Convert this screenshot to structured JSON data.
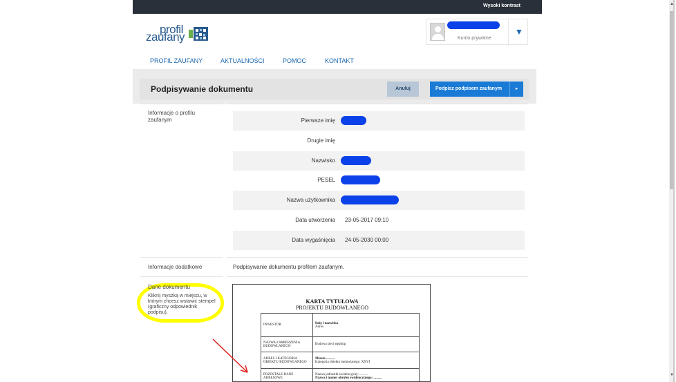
{
  "topbar": {
    "contrast_label": "Wysoki kontrast"
  },
  "logo": {
    "line1": "profil",
    "line2": "zaufany"
  },
  "account": {
    "type_label": "Konto prywatne",
    "chevron": "▼"
  },
  "nav": {
    "items": [
      "PROFIL ZAUFANY",
      "AKTUALNOŚCI",
      "POMOC",
      "KONTAKT"
    ]
  },
  "page": {
    "title": "Podpisywanie dokumentu",
    "cancel_label": "Anuluj",
    "sign_label": "Podpisz podpisem zaufanym",
    "sign_arrow": "▸"
  },
  "sections": {
    "profile_info": "Informacje o profilu zaufanym",
    "additional_info": "Informacje dodatkowe",
    "document_data": "Dane dokumentu",
    "document_hint": "Kliknij myszką w miejscu, w którym chcesz wstawić stempel (graficzny odpowiednik podpisu)."
  },
  "profile_fields": [
    {
      "label": "Pierwsze imię",
      "value": ""
    },
    {
      "label": "Drugie imię",
      "value": ""
    },
    {
      "label": "Nazwisko",
      "value": ""
    },
    {
      "label": "PESEL",
      "value": ""
    },
    {
      "label": "Nazwa użytkownika",
      "value": ""
    },
    {
      "label": "Data utworzenia",
      "value": "23-05-2017 09:10"
    },
    {
      "label": "Data wygaśnięcia",
      "value": "24-05-2030 00:00"
    }
  ],
  "additional_text": "Podpisywanie dokumentu profilem zaufanym.",
  "document": {
    "heading1": "KARTA TYTUŁOWA",
    "heading2": "PROJEKTU BUDOWLANEGO",
    "rows": [
      {
        "label": "INWESTOR",
        "value_bold": "Imię i nazwisko",
        "value": "Adres"
      },
      {
        "label": "NAZWA ZAMIERZENIA BUDOWLANEGO",
        "value_bold": "",
        "value": "Budowa sieci stępling"
      },
      {
        "label": "ADRES I KATEGORIA OBIEKTU BUDOWLANEGO",
        "value_bold": "Miasto ..........",
        "value": "Kategoria obiektu budowlanego: XXVI"
      },
      {
        "label": "POZOSTAŁE DANE ADRESOWE",
        "value_bold": "Nazwa i numer obrębu ewidencyjnego: ..........",
        "value": "Nazwa jednostki ewidencyjnej: .........."
      }
    ]
  },
  "scrollbar": {
    "up": "▲",
    "down": "▼"
  }
}
